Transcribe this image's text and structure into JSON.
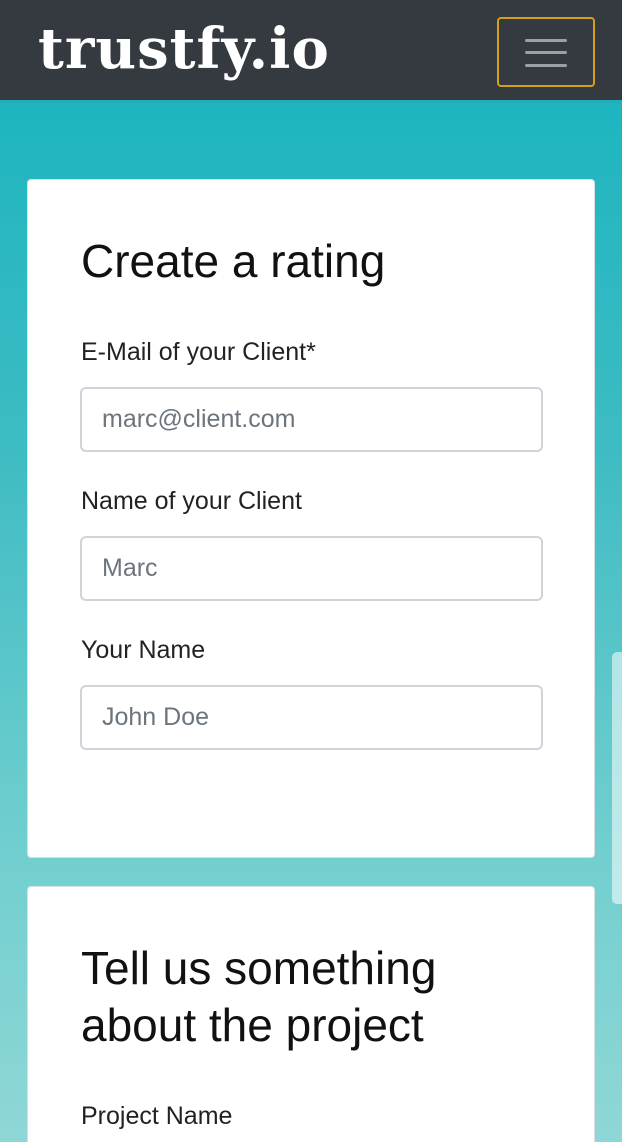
{
  "header": {
    "brand": "trustfy.io",
    "menu_icon": "hamburger-menu-icon",
    "menu_border_color": "#d4a017"
  },
  "rating_card": {
    "title": "Create a rating",
    "fields": [
      {
        "label": "E-Mail of your Client*",
        "placeholder": "marc@client.com",
        "value": ""
      },
      {
        "label": "Name of your Client",
        "placeholder": "Marc",
        "value": ""
      },
      {
        "label": "Your Name",
        "placeholder": "John Doe",
        "value": ""
      }
    ]
  },
  "project_card": {
    "title": "Tell us something about the project",
    "fields": [
      {
        "label": "Project Name"
      }
    ]
  },
  "colors": {
    "navbar": "#343a40",
    "accent": "#14b3bf"
  }
}
